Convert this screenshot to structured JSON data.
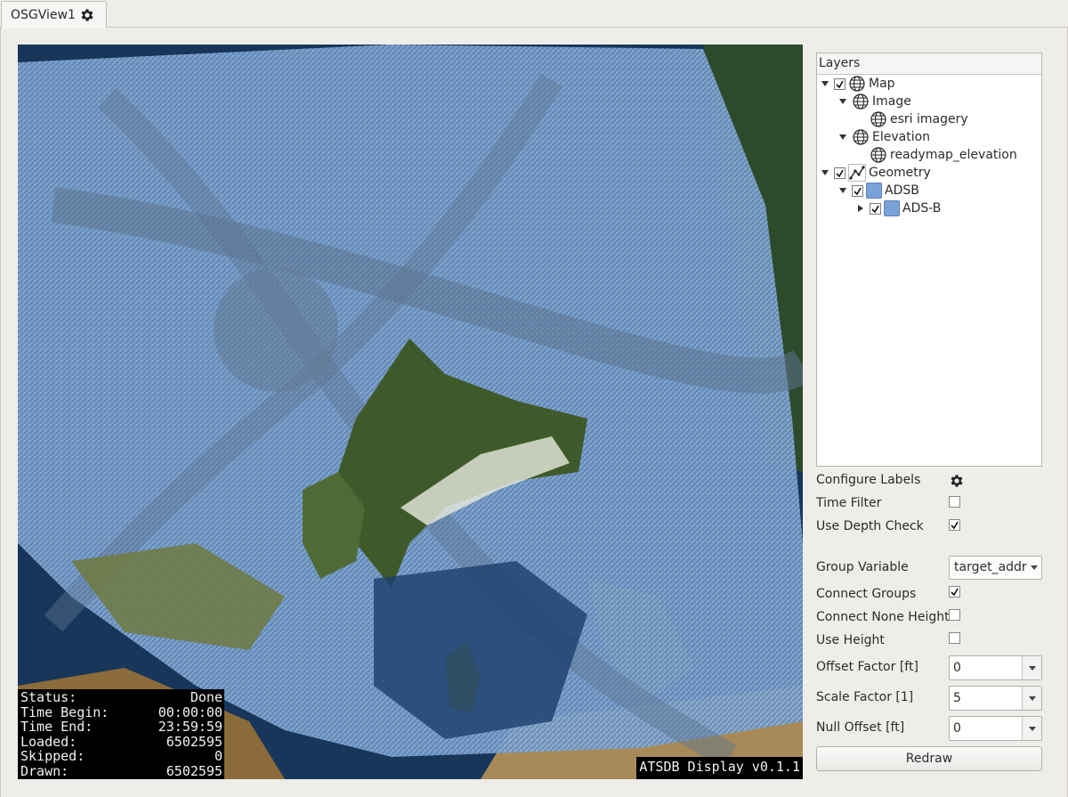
{
  "tab": {
    "title": "OSGView1",
    "icon": "gear-icon"
  },
  "status": {
    "rows": [
      {
        "label": "Status:",
        "value": "Done"
      },
      {
        "label": "Time Begin:",
        "value": "00:00:00"
      },
      {
        "label": "Time End:",
        "value": "23:59:59"
      },
      {
        "label": "Loaded:",
        "value": "6502595"
      },
      {
        "label": "Skipped:",
        "value": "0"
      },
      {
        "label": "Drawn:",
        "value": "6502595"
      }
    ],
    "version": "ATSDB Display v0.1.1"
  },
  "layers": {
    "header": "Layers",
    "items": [
      {
        "label": "Map",
        "expanded": true,
        "checked": true,
        "icon": "globe-icon"
      },
      {
        "label": "Image",
        "expanded": true,
        "icon": "globe-icon"
      },
      {
        "label": "esri imagery",
        "icon": "globe-icon"
      },
      {
        "label": "Elevation",
        "expanded": true,
        "icon": "globe-icon"
      },
      {
        "label": "readymap_elevation",
        "icon": "globe-icon"
      },
      {
        "label": "Geometry",
        "expanded": true,
        "checked": true,
        "icon": "polyline-icon"
      },
      {
        "label": "ADSB",
        "expanded": true,
        "checked": true,
        "icon": "color-swatch"
      },
      {
        "label": "ADS-B",
        "expanded": false,
        "checked": true,
        "icon": "color-swatch"
      }
    ]
  },
  "controls": {
    "configure_labels": "Configure Labels",
    "time_filter": {
      "label": "Time Filter",
      "checked": false
    },
    "use_depth_check": {
      "label": "Use Depth Check",
      "checked": true
    },
    "group_variable": {
      "label": "Group Variable",
      "value": "target_addr"
    },
    "connect_groups": {
      "label": "Connect Groups",
      "checked": true
    },
    "connect_none_height": {
      "label": "Connect None Height",
      "checked": false
    },
    "use_height": {
      "label": "Use Height",
      "checked": false
    },
    "offset_factor": {
      "label": "Offset Factor [ft]",
      "value": "0"
    },
    "scale_factor": {
      "label": "Scale Factor [1]",
      "value": "5"
    },
    "null_offset": {
      "label": "Null Offset [ft]",
      "value": "0"
    },
    "redraw": "Redraw"
  },
  "colors": {
    "track": "#7aa2d8",
    "swatch": "#7aa2d8"
  }
}
